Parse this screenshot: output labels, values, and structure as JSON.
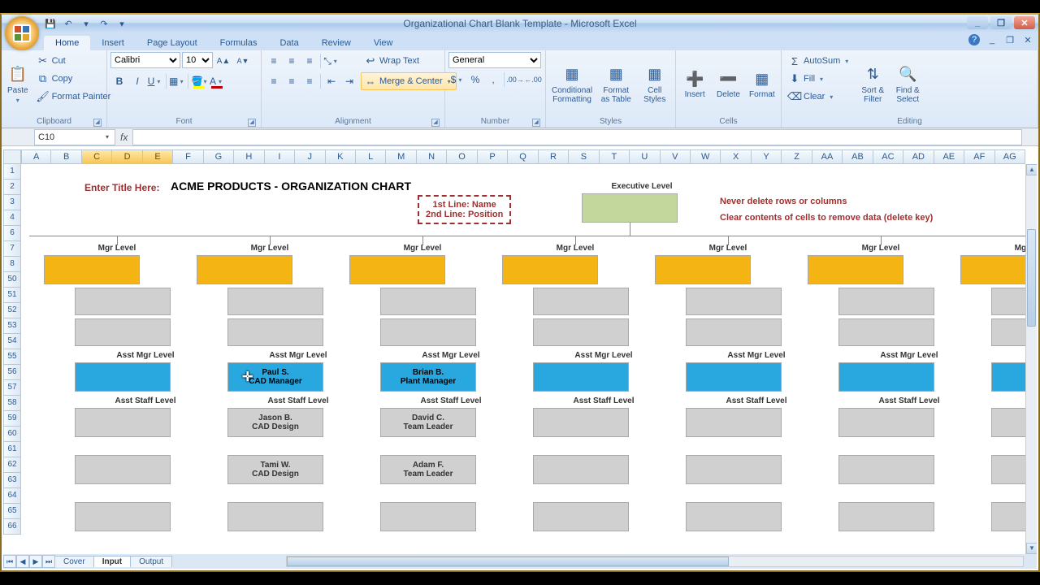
{
  "window": {
    "title": "Organizational Chart Blank Template - Microsoft Excel",
    "qat": {
      "save": "💾",
      "undo": "↶",
      "redo": "↷"
    }
  },
  "ribbon": {
    "tabs": [
      "Home",
      "Insert",
      "Page Layout",
      "Formulas",
      "Data",
      "Review",
      "View"
    ],
    "active_tab": "Home",
    "clipboard": {
      "paste": "Paste",
      "cut": "Cut",
      "copy": "Copy",
      "fmtpainter": "Format Painter",
      "label": "Clipboard"
    },
    "font": {
      "name": "Calibri",
      "size": "10",
      "grow": "A▲",
      "shrink": "A▼",
      "bold": "B",
      "italic": "I",
      "underline": "U",
      "label": "Font"
    },
    "alignment": {
      "wrap": "Wrap Text",
      "merge": "Merge & Center",
      "label": "Alignment"
    },
    "number": {
      "format": "General",
      "label": "Number"
    },
    "styles": {
      "cond": "Conditional Formatting",
      "table": "Format as Table",
      "cell": "Cell Styles",
      "label": "Styles"
    },
    "cells": {
      "insert": "Insert",
      "delete": "Delete",
      "format": "Format",
      "label": "Cells"
    },
    "editing": {
      "autosum": "AutoSum",
      "fill": "Fill",
      "clear": "Clear",
      "sort": "Sort & Filter",
      "find": "Find & Select",
      "label": "Editing"
    }
  },
  "namebox": "C10",
  "columns": [
    "A",
    "B",
    "C",
    "D",
    "E",
    "F",
    "G",
    "H",
    "I",
    "J",
    "K",
    "L",
    "M",
    "N",
    "O",
    "P",
    "Q",
    "R",
    "S",
    "T",
    "U",
    "V",
    "W",
    "X",
    "Y",
    "Z",
    "AA",
    "AB",
    "AC",
    "AD",
    "AE",
    "AF",
    "AG"
  ],
  "selected_cols": [
    "C",
    "D",
    "E"
  ],
  "rows_top": [
    "1",
    "2",
    "3",
    "4",
    "6",
    "7",
    "8"
  ],
  "rows_bot": [
    "50",
    "51",
    "52",
    "53",
    "54",
    "55",
    "56",
    "57",
    "58",
    "59",
    "60",
    "61",
    "62",
    "63",
    "64",
    "65",
    "66"
  ],
  "sheet": {
    "title_prompt": "Enter Title Here:",
    "title": "ACME PRODUCTS - ORGANIZATION CHART",
    "exec_label": "Executive Level",
    "legend1": "1st Line: Name",
    "legend2": "2nd Line: Position",
    "warn1": "Never delete rows or columns",
    "warn2": "Clear contents of cells to remove data (delete key)",
    "mgr_label": "Mgr Level",
    "astmgr_label": "Asst Mgr Level",
    "aststaff_label": "Asst Staff Level",
    "col2": {
      "am_name": "Paul S.",
      "am_pos": "CAD Manager",
      "s1_name": "Jason B.",
      "s1_pos": "CAD Design",
      "s2_name": "Tami W.",
      "s2_pos": "CAD Design"
    },
    "col3": {
      "am_name": "Brian B.",
      "am_pos": "Plant Manager",
      "s1_name": "David C.",
      "s1_pos": "Team Leader",
      "s2_name": "Adam F.",
      "s2_pos": "Team Leader"
    }
  },
  "tabs": {
    "cover": "Cover",
    "input": "Input",
    "output": "Output"
  }
}
